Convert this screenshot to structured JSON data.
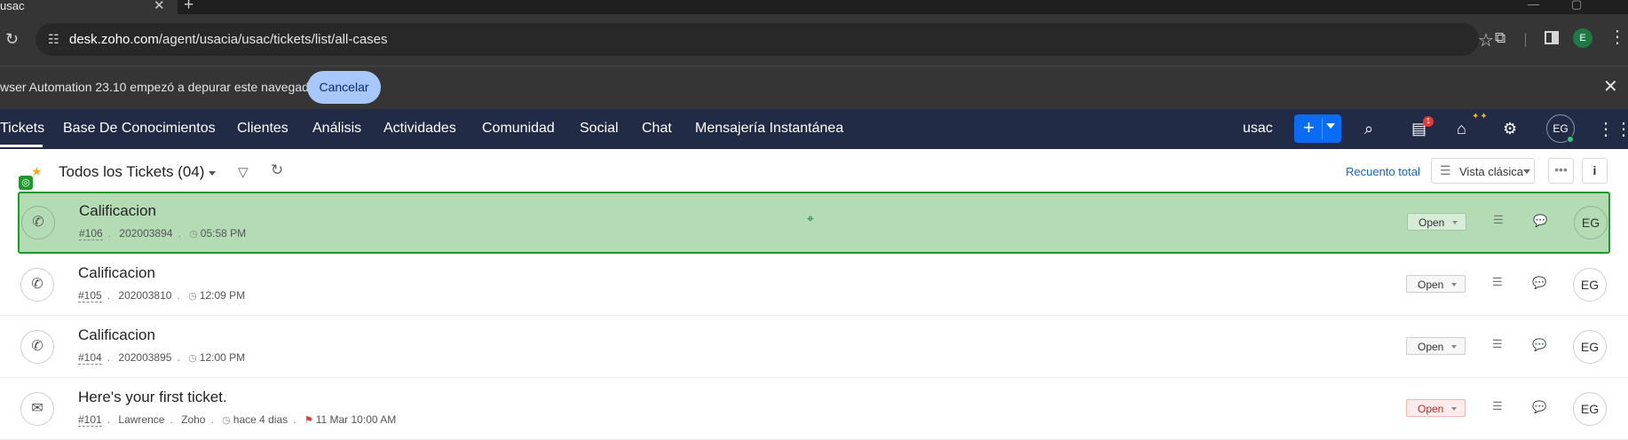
{
  "browser": {
    "tab_title": "usac",
    "tab_close": "✕",
    "new_tab": "+",
    "url_host": "desk.zoho.com",
    "url_path": "/agent/usacia/usac/tickets/list/all-cases",
    "profile_initial": "E",
    "infobar_text": "wser Automation 23.10 empezó a depurar este navegador",
    "infobar_button": "Cancelar",
    "infobar_close": "✕"
  },
  "nav": {
    "items": [
      {
        "label": "Tickets"
      },
      {
        "label": "Base De Conocimientos"
      },
      {
        "label": "Clientes"
      },
      {
        "label": "Análisis"
      },
      {
        "label": "Actividades"
      },
      {
        "label": "Comunidad"
      },
      {
        "label": "Social"
      },
      {
        "label": "Chat"
      },
      {
        "label": "Mensajería Instantánea"
      }
    ],
    "department": "usac",
    "notification_count": "1",
    "avatar_initials": "EG"
  },
  "toolbar": {
    "view_title": "Todos los Tickets (04)",
    "count_link": "Recuento total",
    "view_mode": "Vista clásica",
    "more": "•••",
    "info": "i"
  },
  "tickets": [
    {
      "subject": "Calificacion",
      "number": "#106",
      "contact": "202003894",
      "account": "",
      "time": "05:58 PM",
      "due": "",
      "status": "Open",
      "channel": "phone-icon",
      "agent": "EG",
      "selected": true
    },
    {
      "subject": "Calificacion",
      "number": "#105",
      "contact": "202003810",
      "account": "",
      "time": "12:09 PM",
      "due": "",
      "status": "Open",
      "channel": "phone-icon",
      "agent": "EG",
      "selected": false
    },
    {
      "subject": "Calificacion",
      "number": "#104",
      "contact": "202003895",
      "account": "",
      "time": "12:00 PM",
      "due": "",
      "status": "Open",
      "channel": "phone-icon",
      "agent": "EG",
      "selected": false
    },
    {
      "subject": "Here's your first ticket.",
      "number": "#101",
      "contact": "Lawrence",
      "account": "Zoho",
      "time": "hace 4 dias",
      "due": "11 Mar 10:00 AM",
      "status": "Open",
      "channel": "email-icon",
      "agent": "EG",
      "selected": false,
      "overdue": true
    }
  ],
  "colors": {
    "nav_bg": "#222b45",
    "accent": "#0a6cf5",
    "selected_row": "#b3dcb4",
    "selected_border": "#1e9a2a"
  }
}
